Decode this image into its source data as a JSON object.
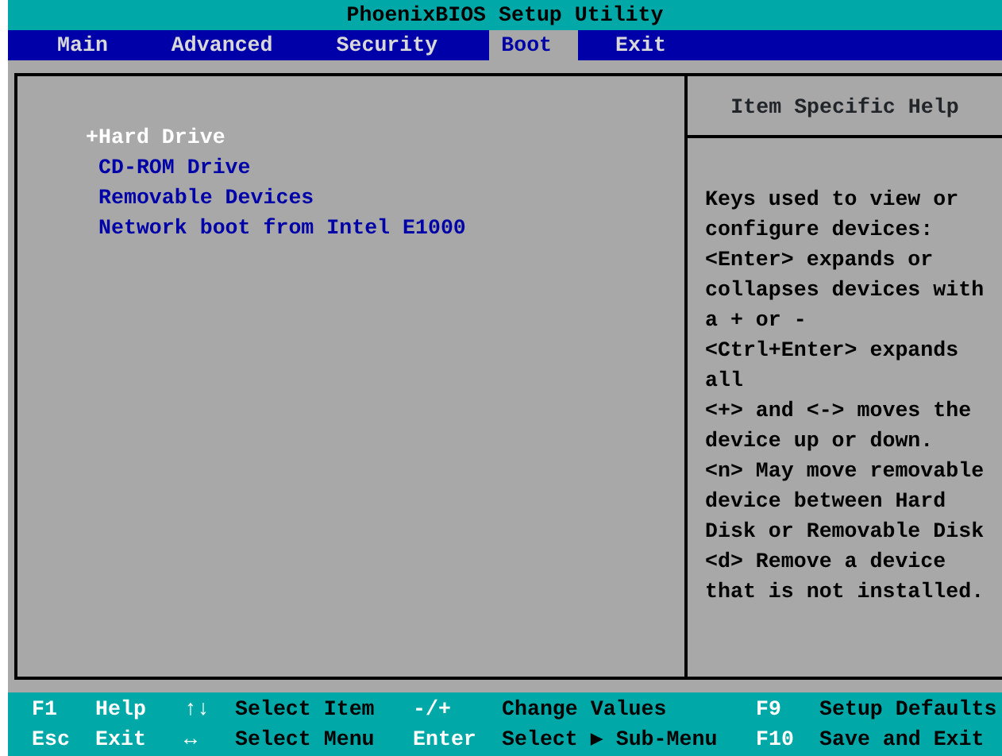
{
  "window": {
    "title": "PhoenixBIOS Setup Utility"
  },
  "tabs": [
    {
      "label": "Main",
      "selected": false
    },
    {
      "label": "Advanced",
      "selected": false
    },
    {
      "label": "Security",
      "selected": false
    },
    {
      "label": "Boot",
      "selected": true
    },
    {
      "label": "Exit",
      "selected": false
    }
  ],
  "boot_items": [
    {
      "toggle": "+",
      "label": "Hard Drive",
      "selected": true
    },
    {
      "label": "CD-ROM Drive",
      "selected": false
    },
    {
      "label": "Removable Devices",
      "selected": false
    },
    {
      "label": "Network boot from Intel E1000",
      "selected": false
    }
  ],
  "help_panel": {
    "title": "Item Specific Help",
    "paragraphs": [
      "Keys used to view or configure devices:",
      "<Enter> expands or collapses devices with a + or -",
      "<Ctrl+Enter> expands all",
      "<+> and <-> moves the device up or down.",
      "<n> May move removable device between Hard Disk or Removable Disk",
      "<d> Remove a device that is not installed."
    ]
  },
  "status_bar": [
    [
      {
        "key": "F1",
        "label": "Help"
      },
      {
        "key": "↑↓",
        "label": "Select Item"
      },
      {
        "key": "-/+",
        "label": "Change Values"
      },
      {
        "key": "F9",
        "label": "Setup Defaults"
      }
    ],
    [
      {
        "key": "Esc",
        "label": "Exit"
      },
      {
        "key": "↔",
        "label": "Select Menu"
      },
      {
        "key": "Enter",
        "label": "Select ▶ Sub-Menu"
      },
      {
        "key": "F10",
        "label": "Save and Exit"
      }
    ]
  ]
}
